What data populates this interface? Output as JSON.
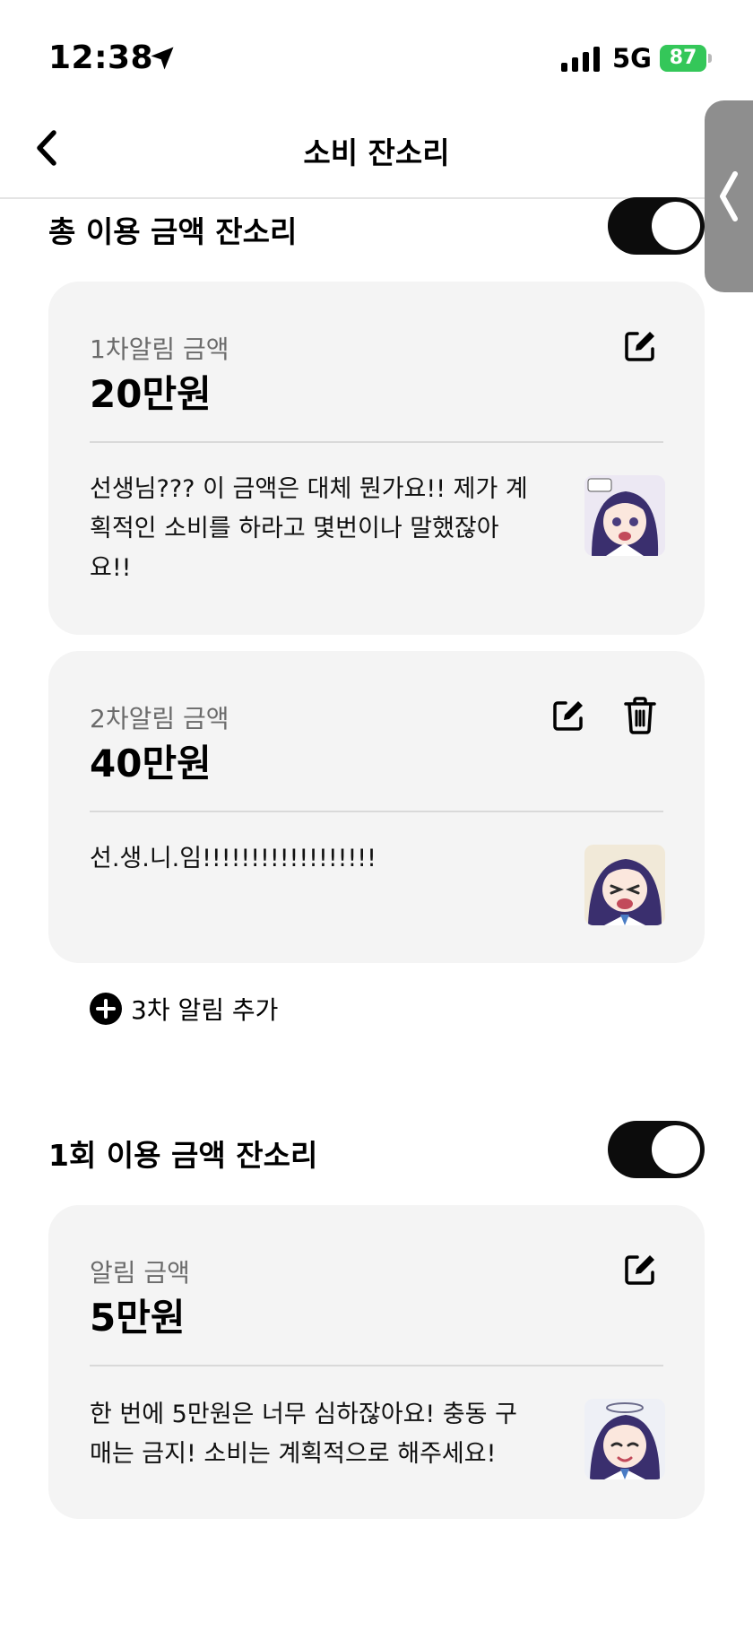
{
  "status_bar": {
    "time": "12:38",
    "network": "5G",
    "battery": "87"
  },
  "nav": {
    "title": "소비 잔소리"
  },
  "total_section": {
    "title": "총 이용 금액 잔소리",
    "enabled": true,
    "alerts": [
      {
        "label": "1차알림 금액",
        "amount": "20만원",
        "message": "선생님??? 이 금액은 대체 뭔가요!! 제가 계획적인 소비를 하라고 몇번이나 말했잖아요!!"
      },
      {
        "label": "2차알림 금액",
        "amount": "40만원",
        "message": "선.생.니.임!!!!!!!!!!!!!!!!!!"
      }
    ],
    "add_label": "3차 알림 추가"
  },
  "single_section": {
    "title": "1회 이용 금액 잔소리",
    "enabled": true,
    "alert": {
      "label": "알림 금액",
      "amount": "5만원",
      "message": "한 번에 5만원은 너무 심하잖아요! 충동 구매는 금지! 소비는 계획적으로 해주세요!"
    }
  },
  "icons": {
    "location": "location-arrow-icon",
    "back": "chevron-left-icon",
    "side_handle": "chevron-left-icon",
    "edit": "edit-icon",
    "delete": "trash-icon",
    "add": "plus-circle-icon"
  },
  "colors": {
    "battery": "#34c759",
    "toggle_on": "#0c0c0c",
    "card_bg": "#f4f4f4"
  }
}
